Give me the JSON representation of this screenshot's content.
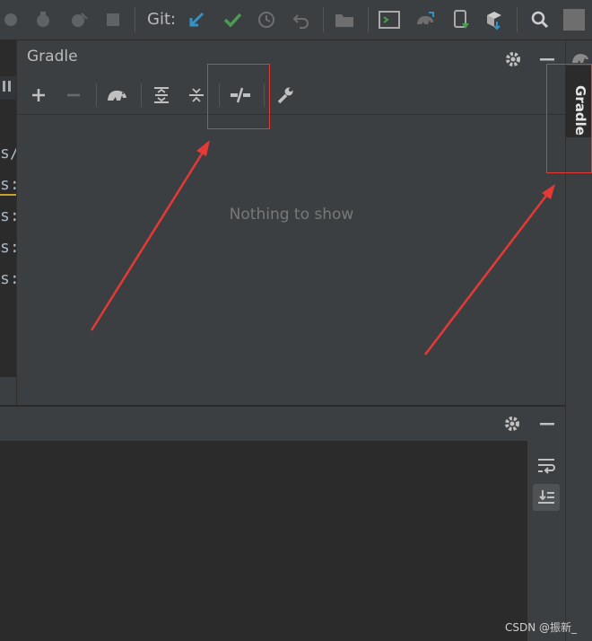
{
  "toolbar": {
    "git_label": "Git:",
    "icons": [
      "run-config-icon",
      "debug-icon",
      "attach-debugger-icon",
      "stop-icon",
      "git-update-icon",
      "git-commit-icon",
      "git-history-icon",
      "git-rollback-icon",
      "vcs-operations-icon",
      "terminal-icon",
      "gradle-sync-icon",
      "device-manager-icon",
      "sdk-manager-icon",
      "search-icon",
      "avatar"
    ]
  },
  "editor": {
    "fragments": [
      "s/",
      "s:",
      "s:",
      "s:",
      "s:"
    ]
  },
  "gradle_panel": {
    "title": "Gradle",
    "empty_text": "Nothing to show",
    "tools": [
      "add-icon",
      "remove-icon",
      "execute-gradle-task-icon",
      "expand-all-icon",
      "collapse-all-icon",
      "toggle-offline-mode-icon",
      "build-tool-settings-icon"
    ]
  },
  "right_stripe": {
    "gradle_tab_label": "Gradle"
  },
  "watermark": "CSDN @振新_",
  "colors": {
    "background": "#3c3f41",
    "editor_bg": "#2b2b2b",
    "accent_blue": "#3592c4",
    "accent_green": "#499c54",
    "annotation_red": "#e53935"
  }
}
